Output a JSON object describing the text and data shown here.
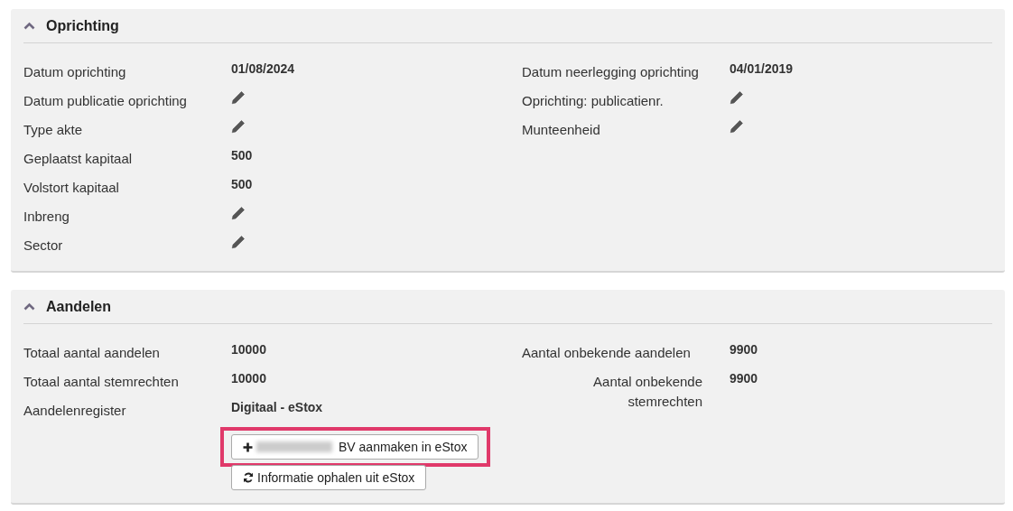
{
  "sections": [
    {
      "title": "Oprichting",
      "expanded": true,
      "left": [
        {
          "label": "Datum oprichting",
          "kind": "text",
          "value": "01/08/2024"
        },
        {
          "label": "Datum publicatie oprichting",
          "kind": "edit"
        },
        {
          "label": "Type akte",
          "kind": "edit"
        },
        {
          "label": "Geplaatst kapitaal",
          "kind": "text",
          "value": "500"
        },
        {
          "label": "Volstort kapitaal",
          "kind": "text",
          "value": "500"
        },
        {
          "label": "Inbreng",
          "kind": "edit"
        },
        {
          "label": "Sector",
          "kind": "edit"
        }
      ],
      "right": [
        {
          "label": "Datum neerlegging oprichting",
          "kind": "text",
          "value": "04/01/2019"
        },
        {
          "label": "Oprichting: publicatienr.",
          "kind": "edit"
        },
        {
          "label": "Munteenheid",
          "kind": "edit"
        }
      ]
    },
    {
      "title": "Aandelen",
      "expanded": true,
      "left": [
        {
          "label": "Totaal aantal aandelen",
          "kind": "text",
          "value": "10000"
        },
        {
          "label": "Totaal aantal stemrechten",
          "kind": "text",
          "value": "10000"
        },
        {
          "label": "Aandelenregister",
          "kind": "text",
          "value": "Digitaal - eStox"
        }
      ],
      "right": [
        {
          "label": "Aantal onbekende aandelen",
          "kind": "text",
          "value": "9900"
        },
        {
          "label": "Aantal onbekende stemrechten",
          "kind": "text",
          "value": "9900"
        }
      ],
      "buttons": [
        {
          "kind": "add",
          "label": "BV aanmaken in eStox",
          "redacted": true,
          "highlighted": true
        },
        {
          "kind": "refresh",
          "label": "Informatie ophalen uit eStox",
          "redacted": false,
          "highlighted": false
        }
      ]
    }
  ]
}
